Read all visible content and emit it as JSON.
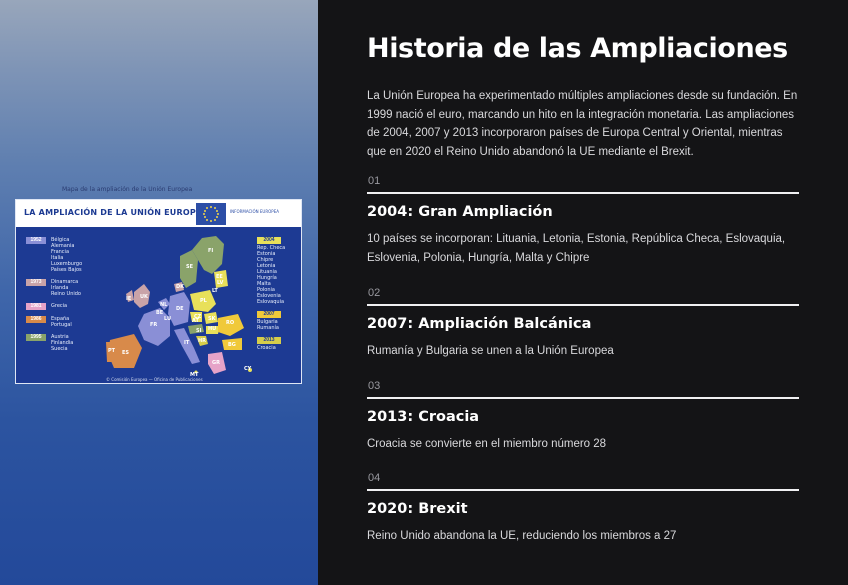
{
  "image": {
    "top_caption": "Mapa de la ampliación de la Unión Europea",
    "title": "LA AMPLIACIÓN DE LA UNIÓN EUROPEA",
    "logo_text": "INFORMACIÓN EUROPEA",
    "footer": "© Comisión Europea — Oficina de Publicaciones",
    "left_legend": [
      {
        "year": "1952",
        "color": "#8a8fd6",
        "countries": "Bélgica\nAlemania\nFrancia\nItalia\nLuxemburgo\nPaíses Bajos"
      },
      {
        "year": "1973",
        "color": "#c9a3a8",
        "countries": "Dinamarca\nIrlanda\nReino Unido"
      },
      {
        "year": "1981",
        "color": "#e6a3c8",
        "countries": "Grecia"
      },
      {
        "year": "1986",
        "color": "#d88a4a",
        "countries": "España\nPortugal"
      },
      {
        "year": "1995",
        "color": "#8aa36a",
        "countries": "Austria\nFinlandia\nSuecia"
      }
    ],
    "right_legend": [
      {
        "year": "2004",
        "color": "#e8e05a",
        "countries": "Rep. Checa\nEstonia\nChipre\nLetonia\nLituania\nHungría\nMalta\nPolonia\nEslovenia\nEslovaquia"
      },
      {
        "year": "2007",
        "color": "#f0c93a",
        "countries": "Bulgaria\nRumanía"
      },
      {
        "year": "2013",
        "color": "#d6cd4a",
        "countries": "Croacia"
      }
    ],
    "map_labels": [
      "IE",
      "UK",
      "NL",
      "BE",
      "DE",
      "FR",
      "ES",
      "PT",
      "IT",
      "AT",
      "DK",
      "SE",
      "FI",
      "PL",
      "CZ",
      "SK",
      "HU",
      "SI",
      "HR",
      "RO",
      "BG",
      "GR",
      "EE",
      "LV",
      "LT",
      "CY",
      "MT",
      "LU"
    ]
  },
  "page": {
    "title": "Historia de las Ampliaciones",
    "intro": "La Unión Europea ha experimentado múltiples ampliaciones desde su fundación. En 1999 nació el euro, marcando un hito en la integración monetaria. Las ampliaciones de 2004, 2007 y 2013 incorporaron países de Europa Central y Oriental, mientras que en 2020 el Reino Unido abandonó la UE mediante el Brexit."
  },
  "timeline": [
    {
      "num": "01",
      "title": "2004: Gran Ampliación",
      "desc": "10 países se incorporan: Lituania, Letonia, Estonia, República Checa, Eslovaquia, Eslovenia, Polonia, Hungría, Malta y Chipre"
    },
    {
      "num": "02",
      "title": "2007: Ampliación Balcánica",
      "desc": "Rumanía y Bulgaria se unen a la Unión Europea"
    },
    {
      "num": "03",
      "title": "2013: Croacia",
      "desc": "Croacia se convierte en el miembro número 28"
    },
    {
      "num": "04",
      "title": "2020: Brexit",
      "desc": "Reino Unido abandona la UE, reduciendo los miembros a 27"
    }
  ]
}
